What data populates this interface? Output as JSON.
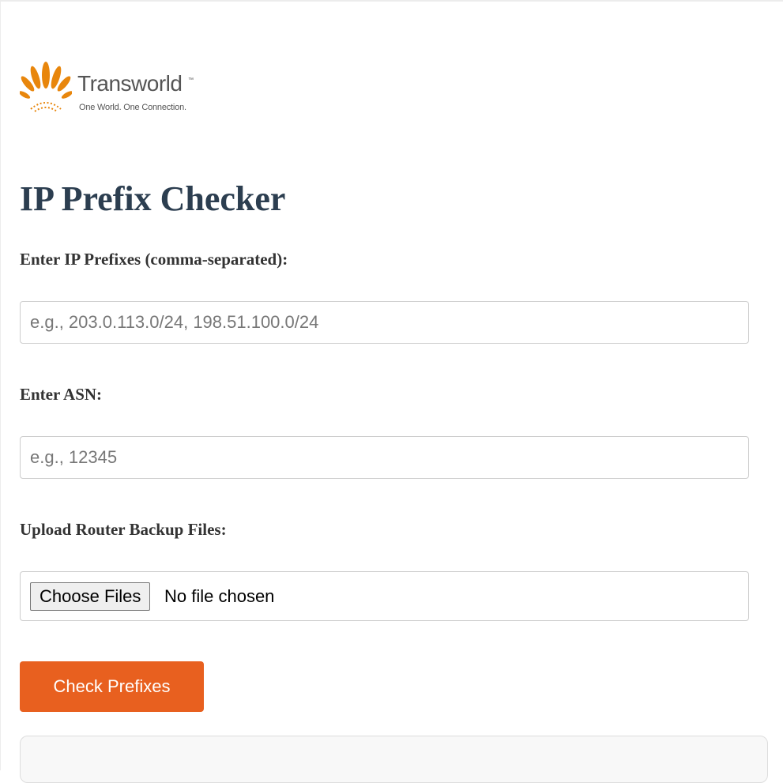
{
  "logo": {
    "brand": "Transworld",
    "trademark": "™",
    "tagline": "One World. One Connection.",
    "icon": "sunburst-logo-icon",
    "color": "#e8860c"
  },
  "page_title": "IP Prefix Checker",
  "form": {
    "prefixes_label": "Enter IP Prefixes (comma-separated):",
    "prefixes_placeholder": "e.g., 203.0.113.0/24, 198.51.100.0/24",
    "prefixes_value": "",
    "asn_label": "Enter ASN:",
    "asn_placeholder": "e.g., 12345",
    "asn_value": "",
    "upload_label": "Upload Router Backup Files:",
    "file_button_label": "Choose Files",
    "file_status": "No file chosen"
  },
  "actions": {
    "check_label": "Check Prefixes",
    "accent_color": "#e8601f"
  },
  "colors": {
    "title": "#2c3e50",
    "label": "#333333"
  }
}
